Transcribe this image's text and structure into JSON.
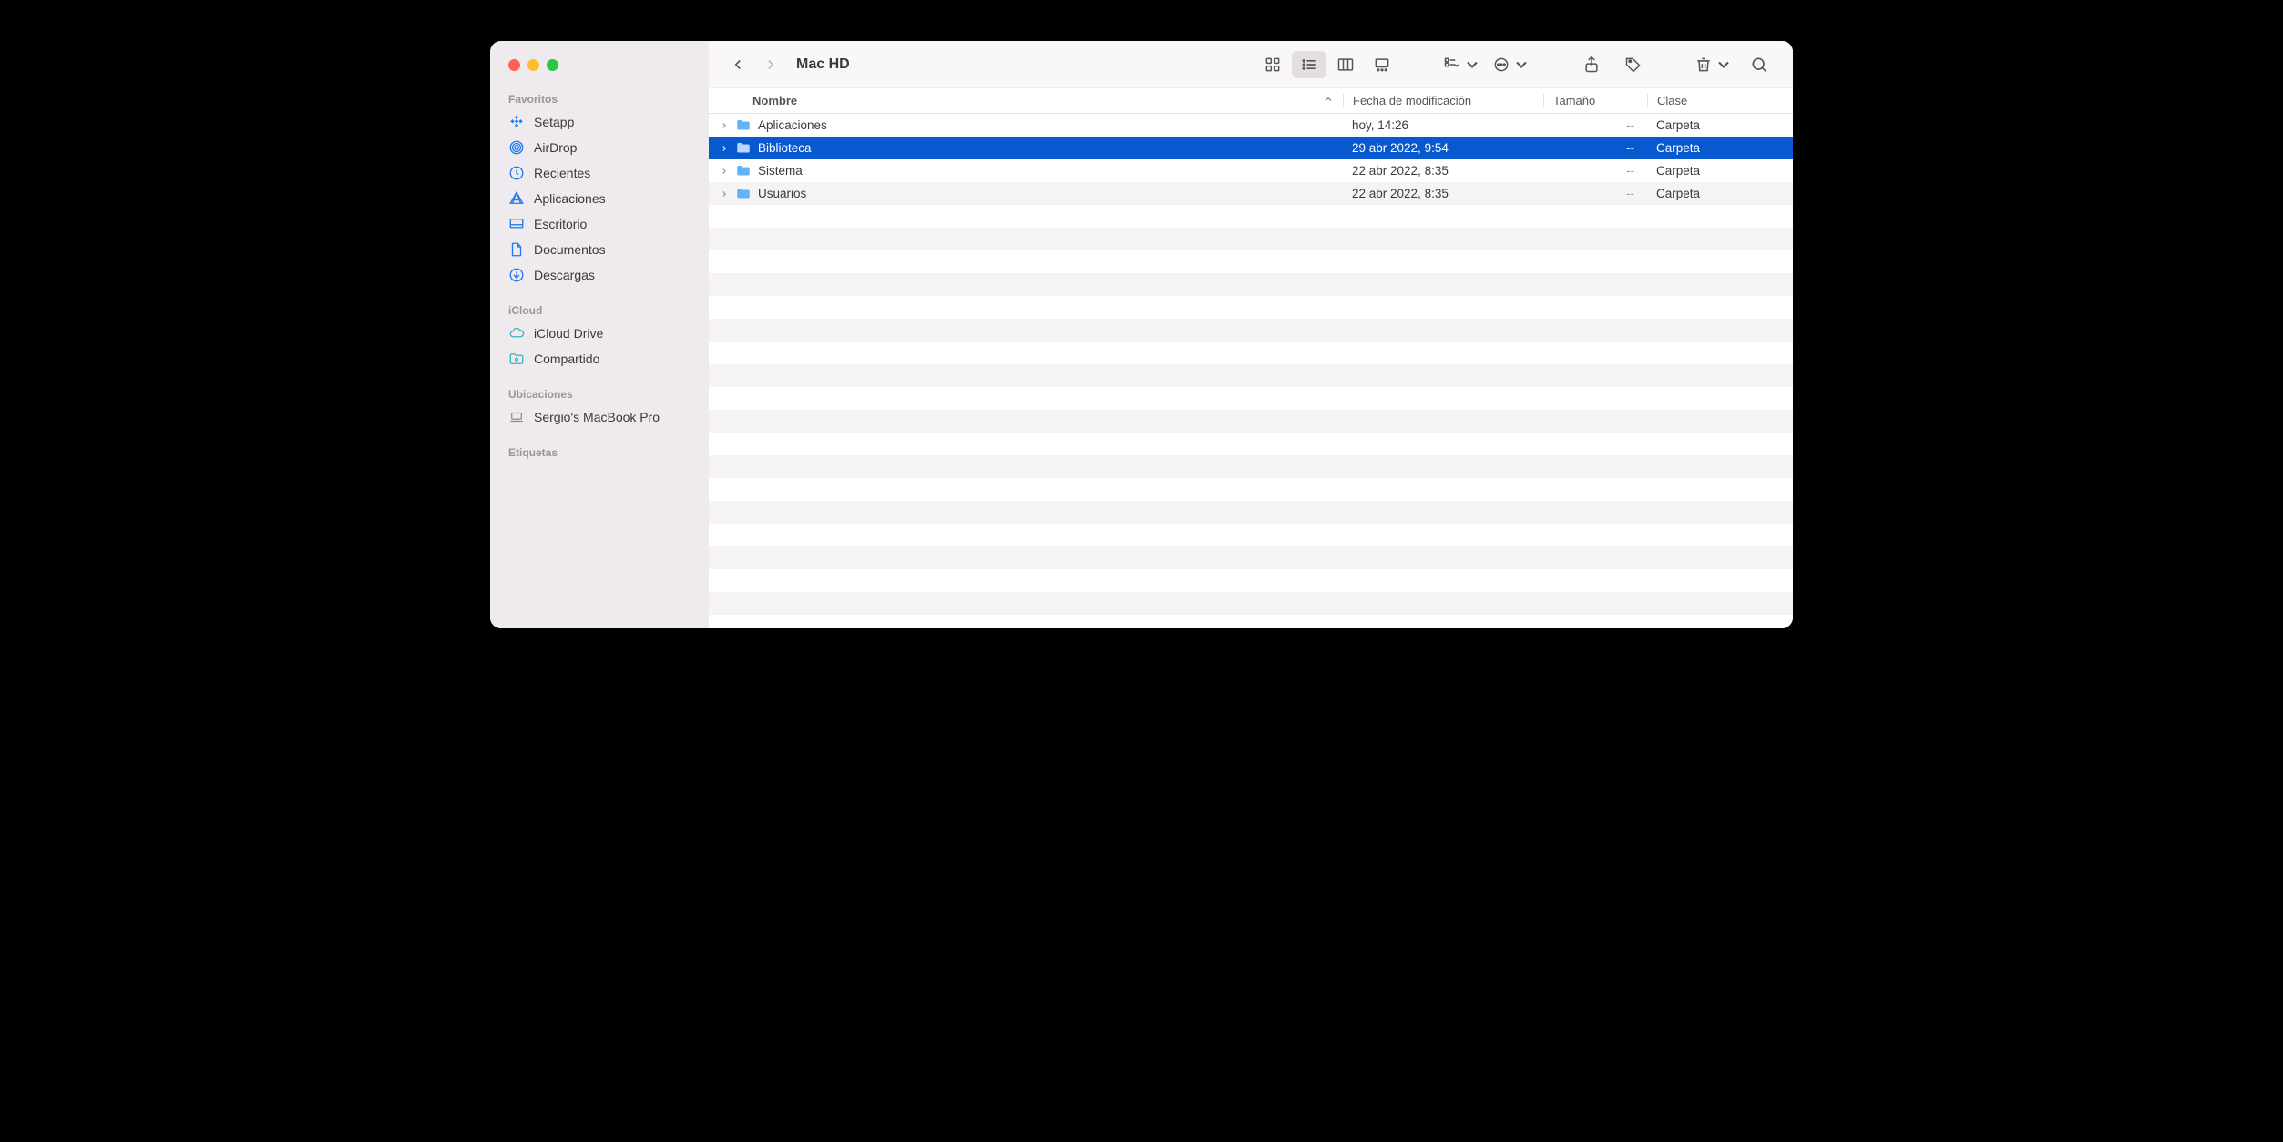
{
  "window": {
    "title": "Mac HD"
  },
  "sidebar": {
    "sections": [
      {
        "label": "Favoritos",
        "items": [
          {
            "icon": "setapp-icon",
            "label": "Setapp",
            "color": "#1e7bf0"
          },
          {
            "icon": "airdrop-icon",
            "label": "AirDrop",
            "color": "#1e7bf0"
          },
          {
            "icon": "clock-icon",
            "label": "Recientes",
            "color": "#1e7bf0"
          },
          {
            "icon": "apps-icon",
            "label": "Aplicaciones",
            "color": "#1e7bf0"
          },
          {
            "icon": "desktop-icon",
            "label": "Escritorio",
            "color": "#1e7bf0"
          },
          {
            "icon": "document-icon",
            "label": "Documentos",
            "color": "#1e7bf0"
          },
          {
            "icon": "download-icon",
            "label": "Descargas",
            "color": "#1e7bf0"
          }
        ]
      },
      {
        "label": "iCloud",
        "items": [
          {
            "icon": "cloud-icon",
            "label": "iCloud Drive",
            "color": "#32b8c6"
          },
          {
            "icon": "shared-folder-icon",
            "label": "Compartido",
            "color": "#32b8c6"
          }
        ]
      },
      {
        "label": "Ubicaciones",
        "items": [
          {
            "icon": "laptop-icon",
            "label": "Sergio's MacBook Pro",
            "color": "#8a8a8a"
          }
        ]
      },
      {
        "label": "Etiquetas",
        "items": []
      }
    ]
  },
  "columns": {
    "name": "Nombre",
    "date": "Fecha de modificación",
    "size": "Tamaño",
    "kind": "Clase"
  },
  "rows": [
    {
      "name": "Aplicaciones",
      "date": "hoy, 14:26",
      "size": "--",
      "kind": "Carpeta",
      "selected": false
    },
    {
      "name": "Biblioteca",
      "date": "29 abr 2022, 9:54",
      "size": "--",
      "kind": "Carpeta",
      "selected": true
    },
    {
      "name": "Sistema",
      "date": "22 abr 2022, 8:35",
      "size": "--",
      "kind": "Carpeta",
      "selected": false
    },
    {
      "name": "Usuarios",
      "date": "22 abr 2022, 8:35",
      "size": "--",
      "kind": "Carpeta",
      "selected": false
    }
  ],
  "colors": {
    "selection": "#0858d0",
    "sidebar_bg": "#efeaed",
    "stripe": "#f6f3f5"
  }
}
